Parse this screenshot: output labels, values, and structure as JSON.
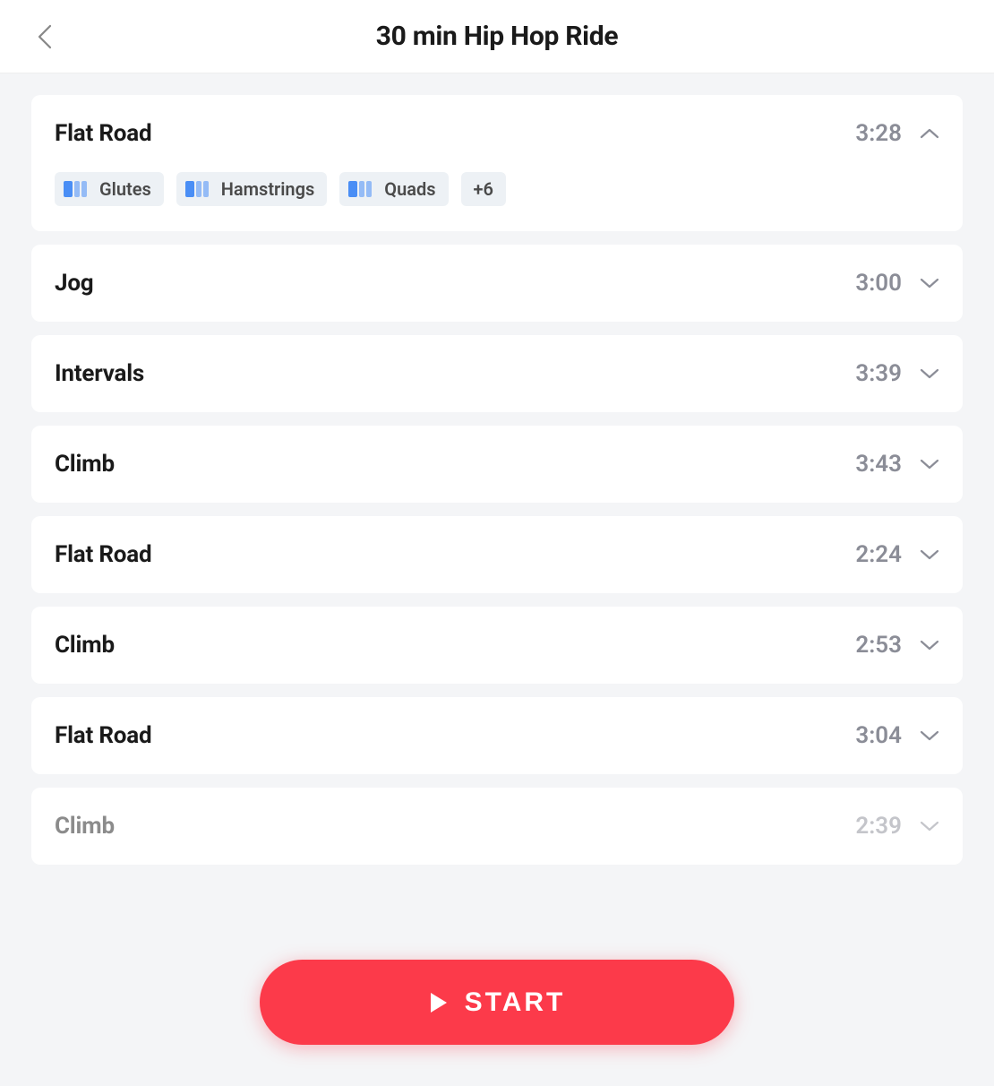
{
  "header": {
    "title": "30 min Hip Hop Ride"
  },
  "segments": [
    {
      "name": "Flat Road",
      "duration": "3:28",
      "expanded": true,
      "tags": [
        "Glutes",
        "Hamstrings",
        "Quads"
      ],
      "more_tags": "+6"
    },
    {
      "name": "Jog",
      "duration": "3:00",
      "expanded": false
    },
    {
      "name": "Intervals",
      "duration": "3:39",
      "expanded": false
    },
    {
      "name": "Climb",
      "duration": "3:43",
      "expanded": false
    },
    {
      "name": "Flat Road",
      "duration": "2:24",
      "expanded": false
    },
    {
      "name": "Climb",
      "duration": "2:53",
      "expanded": false
    },
    {
      "name": "Flat Road",
      "duration": "3:04",
      "expanded": false
    },
    {
      "name": "Climb",
      "duration": "2:39",
      "expanded": false
    }
  ],
  "start_button": {
    "label": "START"
  }
}
